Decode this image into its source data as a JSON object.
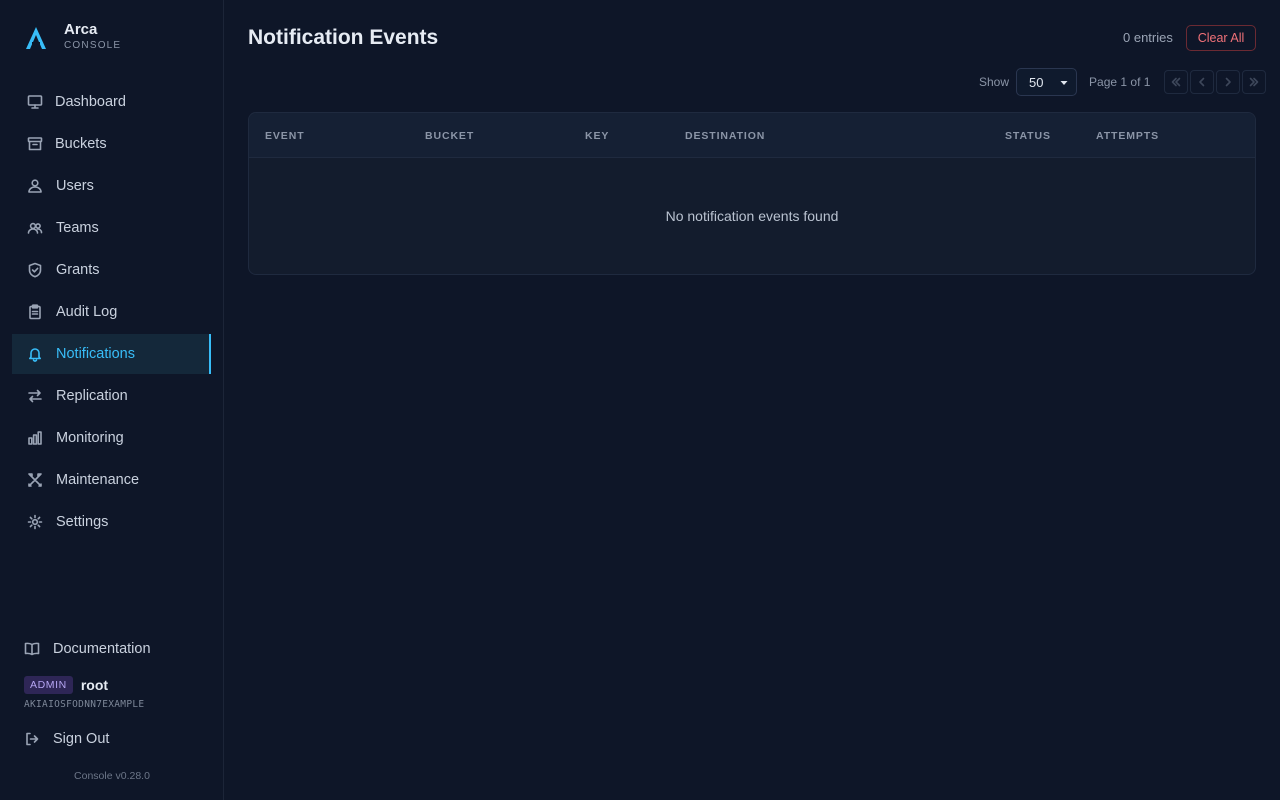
{
  "brand": {
    "name": "Arca",
    "subtitle": "CONSOLE"
  },
  "sidebar": {
    "items": [
      {
        "label": "Dashboard",
        "icon": "monitor-icon"
      },
      {
        "label": "Buckets",
        "icon": "archive-icon"
      },
      {
        "label": "Users",
        "icon": "user-icon"
      },
      {
        "label": "Teams",
        "icon": "users-icon"
      },
      {
        "label": "Grants",
        "icon": "shield-icon"
      },
      {
        "label": "Audit Log",
        "icon": "clipboard-icon"
      },
      {
        "label": "Notifications",
        "icon": "bell-icon",
        "active": true
      },
      {
        "label": "Replication",
        "icon": "arrows-icon"
      },
      {
        "label": "Monitoring",
        "icon": "bar-chart-icon"
      },
      {
        "label": "Maintenance",
        "icon": "tools-icon"
      },
      {
        "label": "Settings",
        "icon": "gear-icon"
      }
    ],
    "documentation": "Documentation",
    "user": {
      "role": "ADMIN",
      "name": "root",
      "access_key": "AKIAIOSFODNN7EXAMPLE"
    },
    "sign_out": "Sign Out",
    "version": "Console v0.28.0"
  },
  "header": {
    "title": "Notification Events",
    "entry_count": "0 entries",
    "clear_label": "Clear All"
  },
  "pagination": {
    "show_label": "Show",
    "page_size": "50",
    "page_info": "Page 1 of 1"
  },
  "table": {
    "columns": [
      "EVENT",
      "BUCKET",
      "KEY",
      "DESTINATION",
      "STATUS",
      "ATTEMPTS"
    ],
    "empty_message": "No notification events found"
  },
  "colors": {
    "accent": "#38bdf8",
    "danger": "#f07178",
    "background": "#0e1628"
  }
}
